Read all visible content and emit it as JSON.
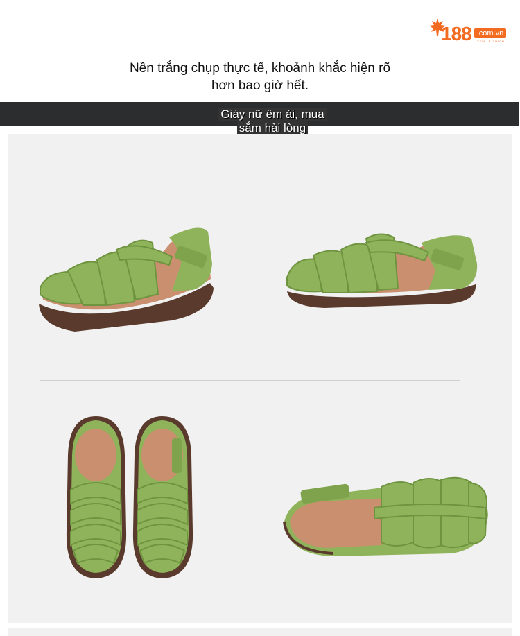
{
  "brand": {
    "logo_number": "188",
    "logo_domain": ".com.vn",
    "logo_tagline": "XEM LÀ THÍCH",
    "color": "#f26b21"
  },
  "headline": {
    "line1": "Nền trắng chụp thực tế, khoảnh khắc hiện rõ",
    "line2": "hơn bao giờ hết."
  },
  "banner": {
    "line1": "Giày nữ êm ái, mua",
    "line2": "sắm hài lòng"
  },
  "colors": {
    "shoe_green": "#8fb35a",
    "shoe_green_dark": "#6f9440",
    "insole": "#c98f6e",
    "sole": "#5a3a2c",
    "background_panel": "#f1f1f1",
    "banner_bg": "#2b2d2f"
  },
  "images": [
    {
      "name": "sandal-side-view-left"
    },
    {
      "name": "sandal-side-view-right"
    },
    {
      "name": "sandal-pair-top-view"
    },
    {
      "name": "sandal-inner-view"
    }
  ]
}
